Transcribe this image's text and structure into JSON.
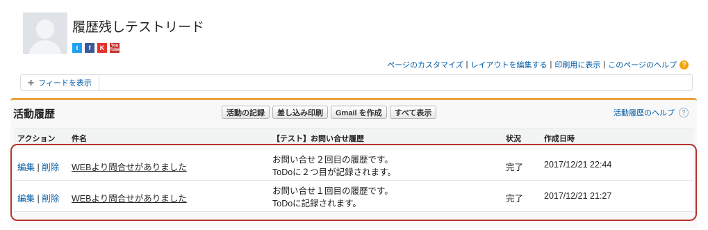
{
  "record": {
    "title": "履歴残しテストリード",
    "social_icons": [
      "twitter-icon",
      "facebook-icon",
      "klout-icon",
      "youtube-icon"
    ]
  },
  "top_links": [
    "ページのカスタマイズ",
    "レイアウトを編集する",
    "印刷用に表示",
    "このページのヘルプ"
  ],
  "feed": {
    "show_feed_label": "フィードを表示"
  },
  "activity": {
    "title": "活動履歴",
    "buttons": [
      "活動の記録",
      "差し込み印刷",
      "Gmail を作成",
      "すべて表示"
    ],
    "help_label": "活動履歴のヘルプ",
    "columns": [
      "アクション",
      "件名",
      "【テスト】お問い合せ履歴",
      "状況",
      "作成日時"
    ],
    "action_edit": "編集",
    "action_delete": "削除",
    "rows": [
      {
        "subject": "WEBより問合せがありました",
        "desc_line1": "お問い合せ２回目の履歴です。",
        "desc_line2": "ToDoに２つ目が記録されます。",
        "status": "完了",
        "created": "2017/12/21 22:44"
      },
      {
        "subject": "WEBより問合せがありました",
        "desc_line1": "お問い合せ１回目の履歴です。",
        "desc_line2": "ToDoに記録されます。",
        "status": "完了",
        "created": "2017/12/21 21:27"
      }
    ]
  },
  "colors": {
    "accent": "#e8a23a",
    "link": "#015ba7",
    "highlight": "#b5322d"
  }
}
